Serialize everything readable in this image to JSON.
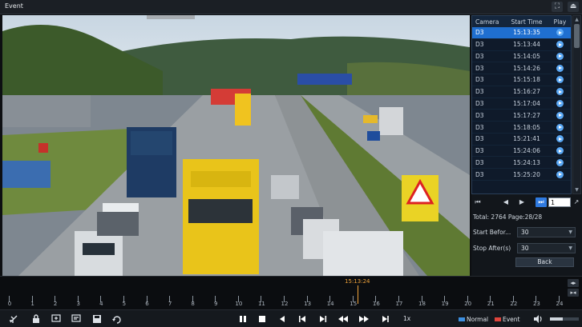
{
  "window": {
    "title": "Event"
  },
  "table": {
    "headers": [
      "Camera",
      "Start Time",
      "Play"
    ],
    "rows": [
      {
        "camera": "D3",
        "time": "15:13:35",
        "selected": true
      },
      {
        "camera": "D3",
        "time": "15:13:44",
        "selected": false
      },
      {
        "camera": "D3",
        "time": "15:14:05",
        "selected": false
      },
      {
        "camera": "D3",
        "time": "15:14:26",
        "selected": false
      },
      {
        "camera": "D3",
        "time": "15:15:18",
        "selected": false
      },
      {
        "camera": "D3",
        "time": "15:16:27",
        "selected": false
      },
      {
        "camera": "D3",
        "time": "15:17:04",
        "selected": false
      },
      {
        "camera": "D3",
        "time": "15:17:27",
        "selected": false
      },
      {
        "camera": "D3",
        "time": "15:18:05",
        "selected": false
      },
      {
        "camera": "D3",
        "time": "15:21:41",
        "selected": false
      },
      {
        "camera": "D3",
        "time": "15:24:06",
        "selected": false
      },
      {
        "camera": "D3",
        "time": "15:24:13",
        "selected": false
      },
      {
        "camera": "D3",
        "time": "15:25:20",
        "selected": false
      }
    ]
  },
  "pager": {
    "page_input": "1"
  },
  "summary": {
    "total": "Total: 2764  Page:28/28"
  },
  "filters": {
    "start_before_label": "Start Befor...",
    "start_before_value": "30",
    "stop_after_label": "Stop After(s)",
    "stop_after_value": "30",
    "back_label": "Back"
  },
  "timeline": {
    "current_time": "15:13:24",
    "current_hour": 15.22,
    "hours": [
      "0",
      "1",
      "2",
      "3",
      "4",
      "5",
      "6",
      "7",
      "8",
      "9",
      "10",
      "11",
      "12",
      "13",
      "14",
      "15",
      "16",
      "17",
      "18",
      "19",
      "20",
      "21",
      "22",
      "23",
      "24"
    ]
  },
  "toolbar": {
    "speed": "1x",
    "legend_normal": "Normal",
    "legend_event": "Event",
    "volume": 0.45,
    "icons": [
      "clip-icon",
      "lock-icon",
      "tag-add-icon",
      "tag-list-icon",
      "save-icon",
      "rotate-icon",
      "pause-icon",
      "stop-icon",
      "step-back-icon",
      "frame-back-icon",
      "frame-forward-icon",
      "rewind-icon",
      "fast-forward-icon",
      "step-forward-icon",
      "volume-icon"
    ]
  },
  "colors": {
    "accent": "#1f6fd0",
    "timeline_marker": "#f0a33a",
    "normal": "#3d8fe0",
    "event": "#e0453d"
  }
}
